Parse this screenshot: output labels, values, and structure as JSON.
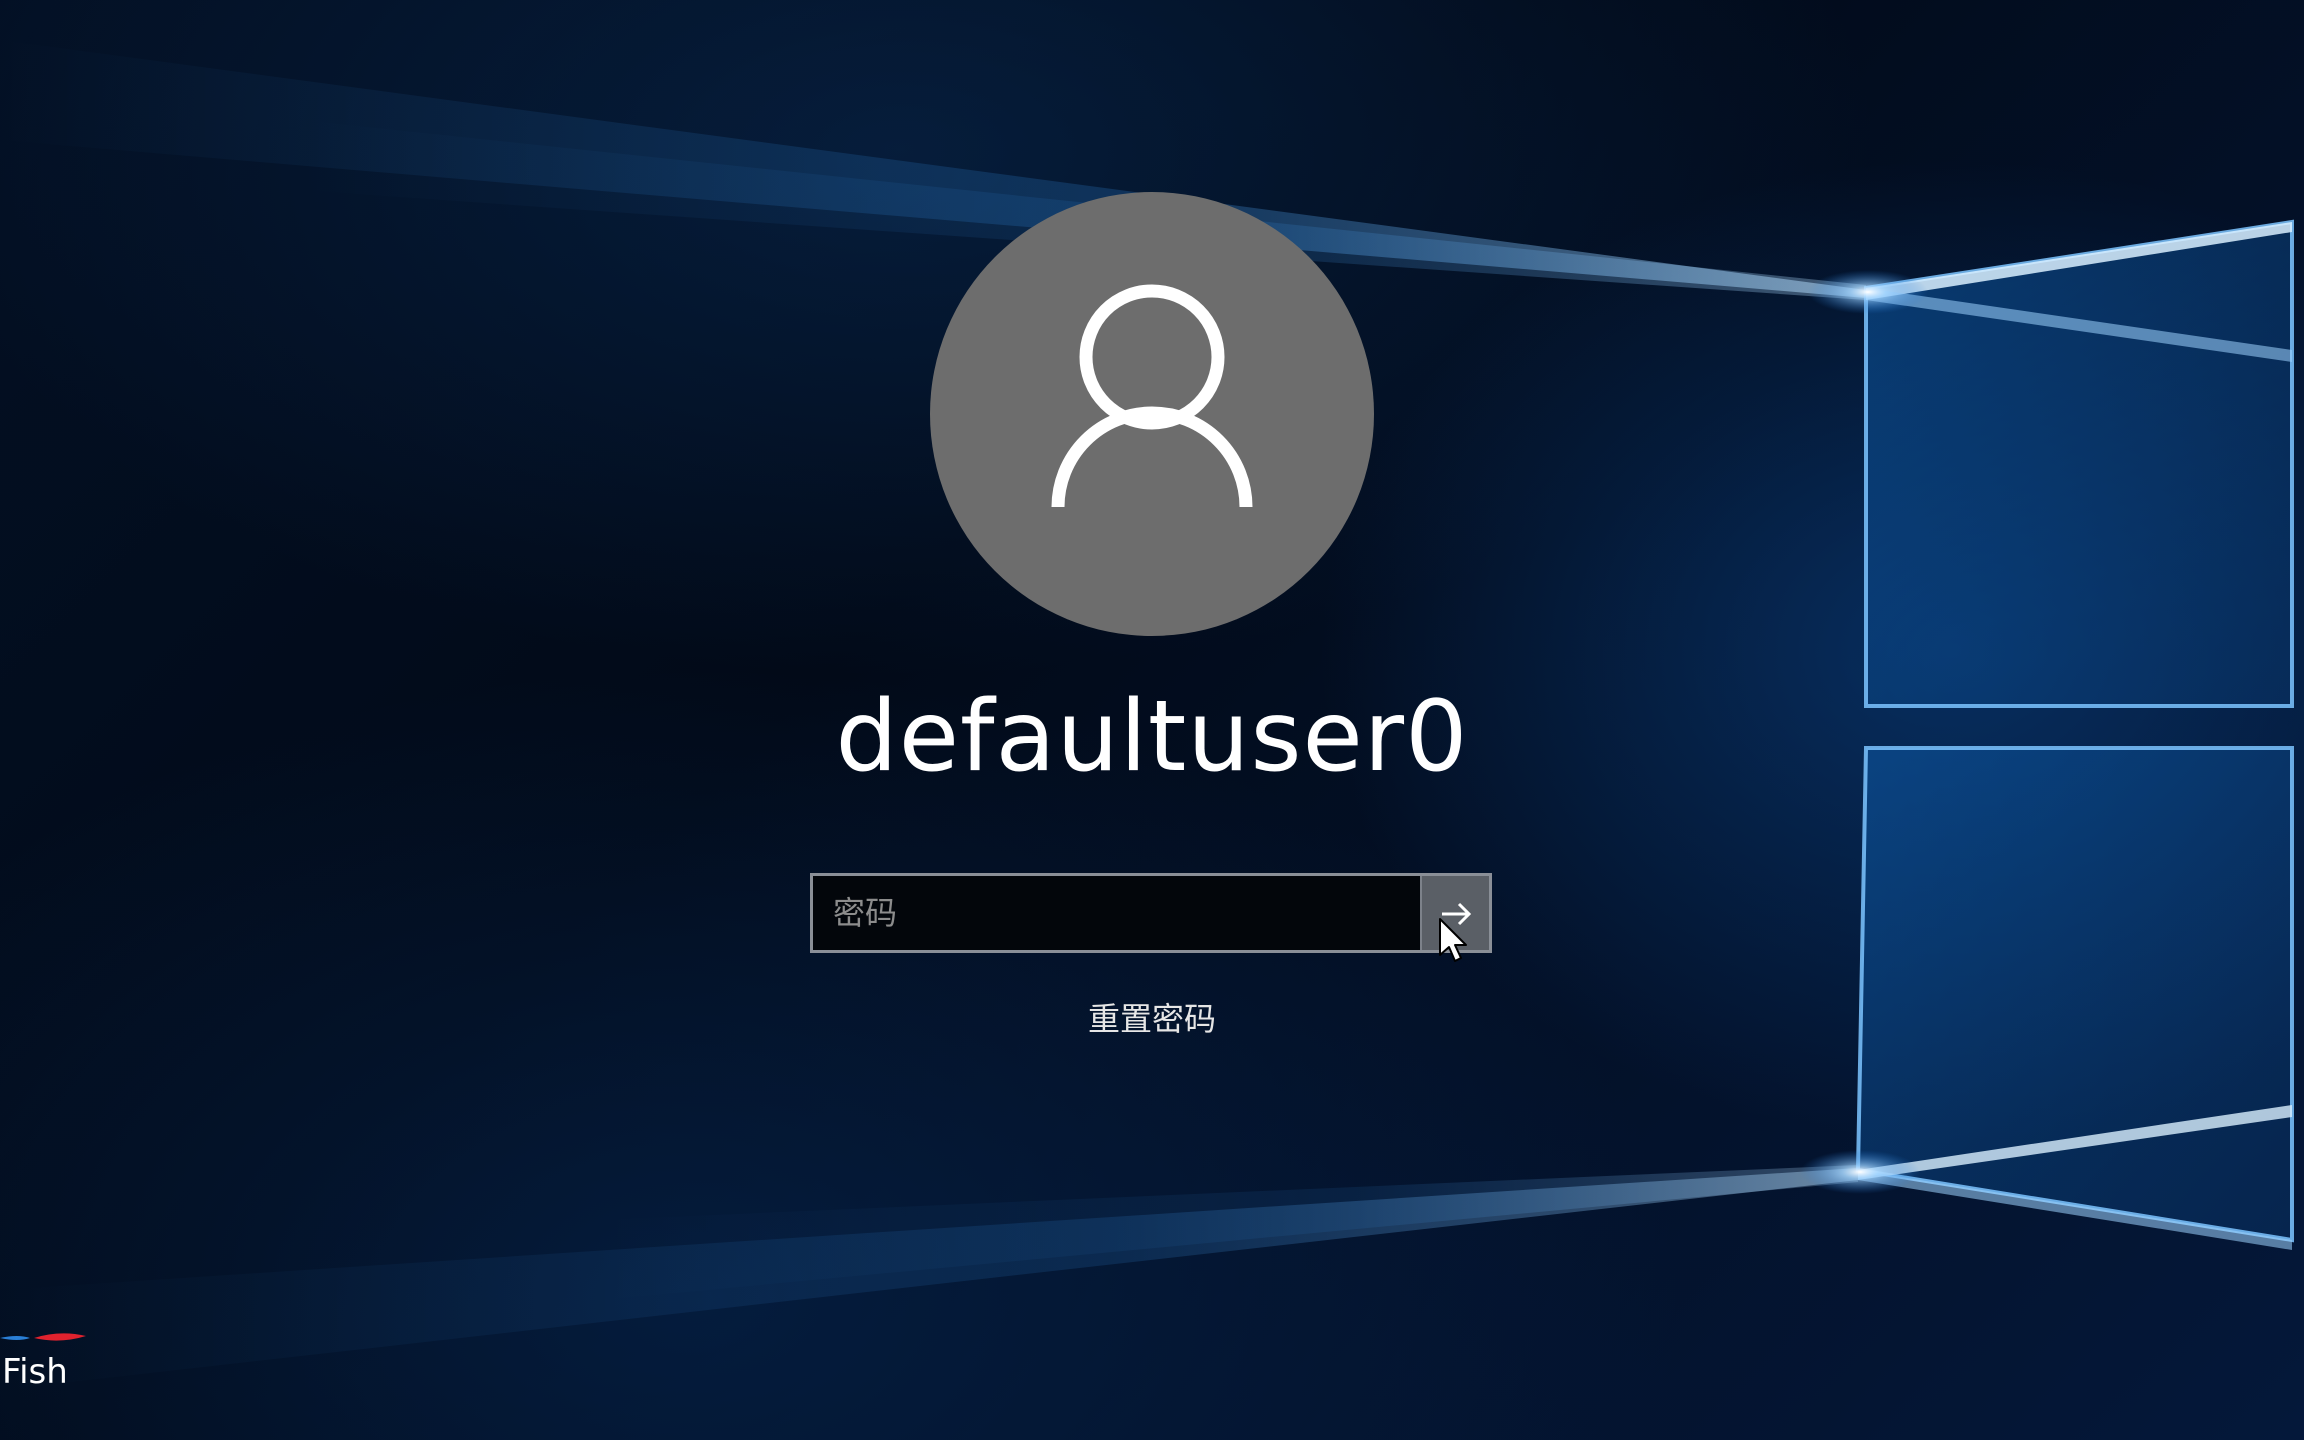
{
  "login": {
    "username": "defaultuser0",
    "password_placeholder": "密码",
    "password_value": "",
    "reset_password_label": "重置密码"
  },
  "icons": {
    "avatar": "user-avatar-icon",
    "submit": "arrow-right-icon",
    "cursor": "mouse-pointer-icon"
  },
  "watermark": {
    "text": "Fish"
  },
  "colors": {
    "background": "#020b1a",
    "avatar_bg": "#6d6d6d",
    "submit_bg": "#5a5f66",
    "input_border": "#8a8f97",
    "accent_blue": "#1e90ff"
  }
}
